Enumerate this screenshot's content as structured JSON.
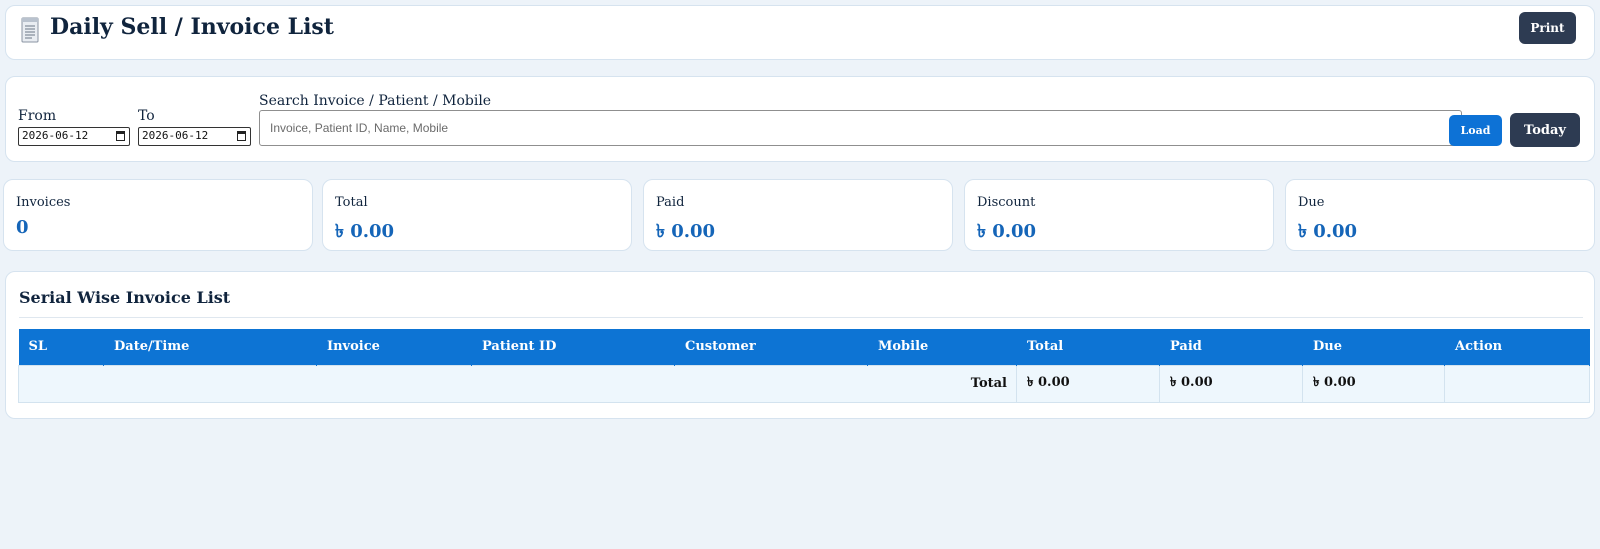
{
  "header": {
    "title": "Daily Sell / Invoice List",
    "print_label": "Print",
    "icon": "receipt-icon"
  },
  "filters": {
    "from_label": "From",
    "from_value": "2026-06-12",
    "to_label": "To",
    "to_value": "2026-06-12",
    "search_label": "Search Invoice / Patient / Mobile",
    "search_placeholder": "Invoice, Patient ID, Name, Mobile",
    "search_value": "",
    "load_label": "Load",
    "today_label": "Today"
  },
  "stats": [
    {
      "label": "Invoices",
      "value": "0"
    },
    {
      "label": "Total",
      "value": "৳ 0.00"
    },
    {
      "label": "Paid",
      "value": "৳ 0.00"
    },
    {
      "label": "Discount",
      "value": "৳ 0.00"
    },
    {
      "label": "Due",
      "value": "৳ 0.00"
    }
  ],
  "list": {
    "title": "Serial Wise Invoice List",
    "columns": [
      "SL",
      "Date/Time",
      "Invoice",
      "Patient ID",
      "Customer",
      "Mobile",
      "Total",
      "Paid",
      "Due",
      "Action"
    ],
    "rows": [],
    "footer": {
      "label": "Total",
      "total": "৳ 0.00",
      "paid": "৳ 0.00",
      "due": "৳ 0.00"
    }
  },
  "colors": {
    "accent_blue": "#0d74d4",
    "dark_button": "#2d3b52",
    "stat_value": "#1565b8",
    "page_background": "#edf3f9"
  }
}
